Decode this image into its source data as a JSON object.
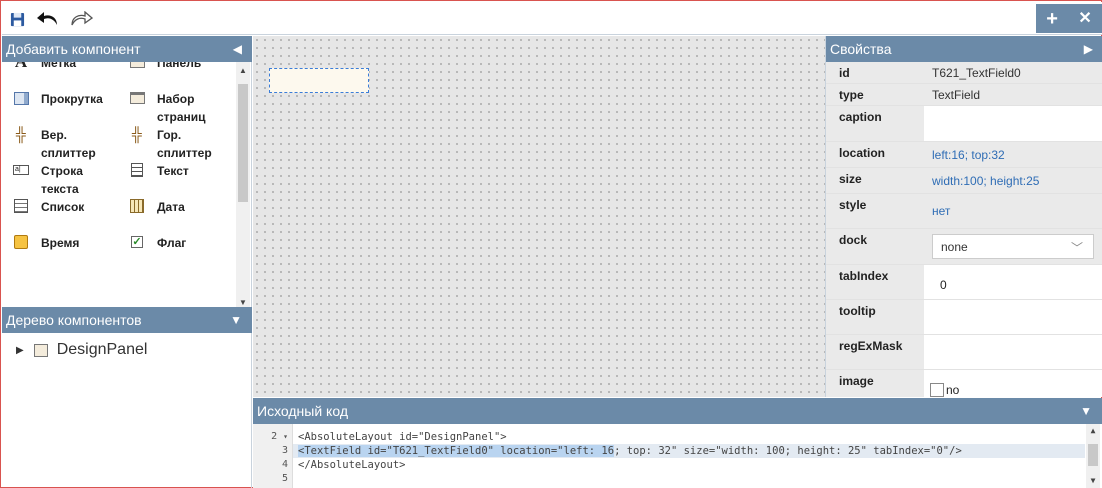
{
  "toolbar": {
    "add_label": "+",
    "close_label": "✕"
  },
  "palette": {
    "title": "Добавить компонент",
    "items": [
      {
        "label": "Метка",
        "icon": "label-icon"
      },
      {
        "label": "Панель",
        "icon": "panel-icon"
      },
      {
        "label": "Прокрутка",
        "icon": "scroll-icon"
      },
      {
        "label": "Набор страниц",
        "icon": "pageset-icon"
      },
      {
        "label": "Вер. сплиттер",
        "icon": "vsplitter-icon"
      },
      {
        "label": "Гор. сплиттер",
        "icon": "hsplitter-icon"
      },
      {
        "label": "Строка текста",
        "icon": "textline-icon"
      },
      {
        "label": "Текст",
        "icon": "text-icon"
      },
      {
        "label": "Список",
        "icon": "list-icon"
      },
      {
        "label": "Дата",
        "icon": "date-icon"
      },
      {
        "label": "Время",
        "icon": "time-icon"
      },
      {
        "label": "Флаг",
        "icon": "checkbox-icon"
      }
    ]
  },
  "tree": {
    "title": "Дерево компонентов",
    "root": "DesignPanel"
  },
  "properties": {
    "title": "Свойства",
    "rows": [
      {
        "name": "id",
        "value": "T621_TextField0"
      },
      {
        "name": "type",
        "value": "TextField"
      },
      {
        "name": "caption",
        "value": ""
      },
      {
        "name": "location",
        "value": "left:16; top:32"
      },
      {
        "name": "size",
        "value": "width:100; height:25"
      },
      {
        "name": "style",
        "value": "нет"
      },
      {
        "name": "dock",
        "value": "none"
      },
      {
        "name": "tabIndex",
        "value": "0"
      },
      {
        "name": "tooltip",
        "value": ""
      },
      {
        "name": "regExMask",
        "value": ""
      },
      {
        "name": "image",
        "value": "no"
      }
    ]
  },
  "source": {
    "title": "Исходный код",
    "lines": [
      {
        "num": "2",
        "fold": "▾",
        "text": "<AbsoluteLayout id=\"DesignPanel\">"
      },
      {
        "num": "3",
        "fold": "",
        "text": "<TextField id=\"T621_TextField0\" location=\"left: 16; top: 32\" size=\"width: 100; height: 25\" tabIndex=\"0\"/>"
      },
      {
        "num": "4",
        "fold": "",
        "text": "</AbsoluteLayout>"
      },
      {
        "num": "5",
        "fold": "",
        "text": ""
      }
    ]
  },
  "colors": {
    "header": "#6b8aa8",
    "selection": "#b9d4f0",
    "value_link": "#2f6db5"
  }
}
